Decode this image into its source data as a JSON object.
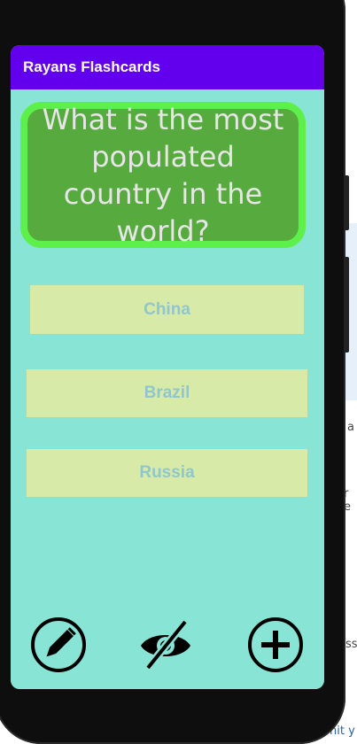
{
  "app": {
    "title": "Rayans Flashcards"
  },
  "flashcard": {
    "question": "What is the most populated country in the world?",
    "answers": [
      "China",
      "Brazil",
      "Russia"
    ]
  },
  "actions": {
    "edit_icon": "pencil-icon",
    "toggle_icon": "eye-off-icon",
    "add_icon": "plus-circle-icon"
  },
  "colors": {
    "appbar": "#6200ee",
    "screen_bg": "#88e4d4",
    "card_bg": "#57ab3e",
    "card_border": "#5ef04a",
    "answer_bg": "#d8eaa7",
    "answer_text": "#8fc6cf"
  },
  "background": {
    "fragments": [
      "s",
      "a",
      "r e",
      "ss",
      "nit y"
    ]
  }
}
